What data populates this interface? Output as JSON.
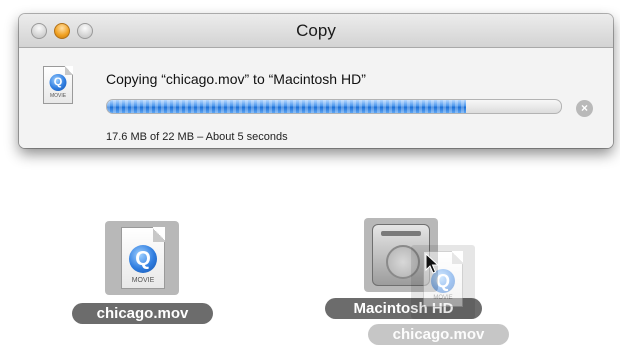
{
  "window": {
    "title": "Copy",
    "status": "Copying “chicago.mov” to “Macintosh HD”",
    "progress_fraction": 0.79,
    "size_status": "17.6 MB of 22 MB – About 5 seconds",
    "stop_icon": "stop-x-icon",
    "file_icon": "quicktime-movie-icon"
  },
  "icons": {
    "movie_glyph": "Q",
    "movie_type_label": "MOVIE"
  },
  "desktop": {
    "file_label": "chicago.mov",
    "drive_label": "Macintosh HD",
    "drag_ghost_label": "chicago.mov"
  },
  "colors": {
    "progress": "#2f7de0",
    "label_pill": "#6c6c6c"
  }
}
